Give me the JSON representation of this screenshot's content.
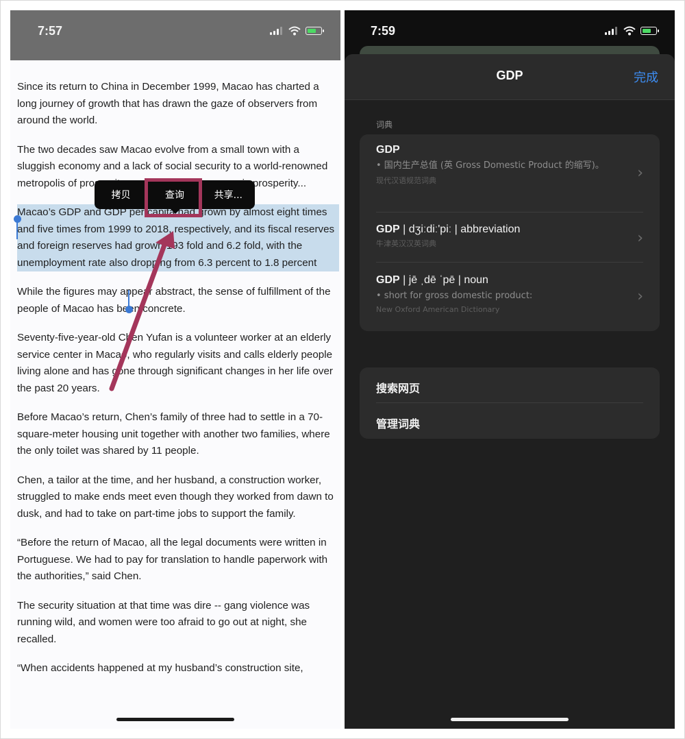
{
  "left": {
    "status_time": "7:57",
    "paragraphs": [
      "Since its return to China in December 1999, Macao has charted a long journey of growth that has drawn the gaze of observers from around the world.",
      "The two decades saw Macao evolve from a small town with a sluggish economy and a lack of social security to a world-renowned metropolis of prosperity, social harmony, economic prosperity...",
      "Macao’s GDP and GDP per capita had grown by almost eight times and five times from 1999 to 2018, respectively, and its fiscal reserves and foreign reserves had grown 193 fold and 6.2 fold, with the unemployment rate also dropping from 6.3 percent to 1.8 percent",
      "While the figures may appear abstract, the sense of fulfillment of the people of Macao has been concrete.",
      "Seventy-five-year-old Chen Yufan is a volunteer worker at an elderly service center in Macao, who regularly visits and calls elderly people living alone and has gone through significant changes in her life over the past 20 years.",
      "Before Macao’s return, Chen’s family of three had to settle in a 70-square-meter housing unit together with another two families, where the only toilet was shared by 11 people.",
      "Chen, a tailor at the time, and her husband, a construction worker, struggled to make ends meet even though they worked from dawn to dusk, and had to take on part-time jobs to support the family.",
      "“Before the return of Macao, all the legal documents were written in Portuguese. We had to pay for translation to handle paperwork with the authorities,” said Chen.",
      "The security situation at that time was dire -- gang violence was running wild, and women were too afraid to go out at night, she recalled.",
      "“When accidents happened at my husband’s construction site,"
    ],
    "edit_menu": {
      "copy": "拷贝",
      "lookup": "查询",
      "share": "共享..."
    }
  },
  "right": {
    "status_time": "7:59",
    "sheet_title": "GDP",
    "done_label": "完成",
    "section_label": "词典",
    "entries": [
      {
        "term": "GDP",
        "extra": "",
        "definition": "• 国内生产总值 (英 Gross Domestic Product 的缩写)。",
        "source": "现代汉语规范词典"
      },
      {
        "term": "GDP",
        "extra": " | dʒiːdiː'piː | abbreviation",
        "definition": "",
        "source": "牛津英汉汉英词典"
      },
      {
        "term": "GDP",
        "extra": " | jē ˌdē ˈpē | noun",
        "definition": "• short for gross domestic product:",
        "source": "New Oxford American Dictionary"
      }
    ],
    "actions": {
      "search_web": "搜索网页",
      "manage_dict": "管理词典"
    }
  },
  "colors": {
    "selection": "#c8dcec",
    "handle": "#3b79d4",
    "annotation": "#a4365b",
    "link": "#3d8df2",
    "battery_green": "#4cd964"
  },
  "icons": [
    "signal-icon",
    "wifi-icon",
    "battery-icon",
    "chevron-right-icon"
  ]
}
